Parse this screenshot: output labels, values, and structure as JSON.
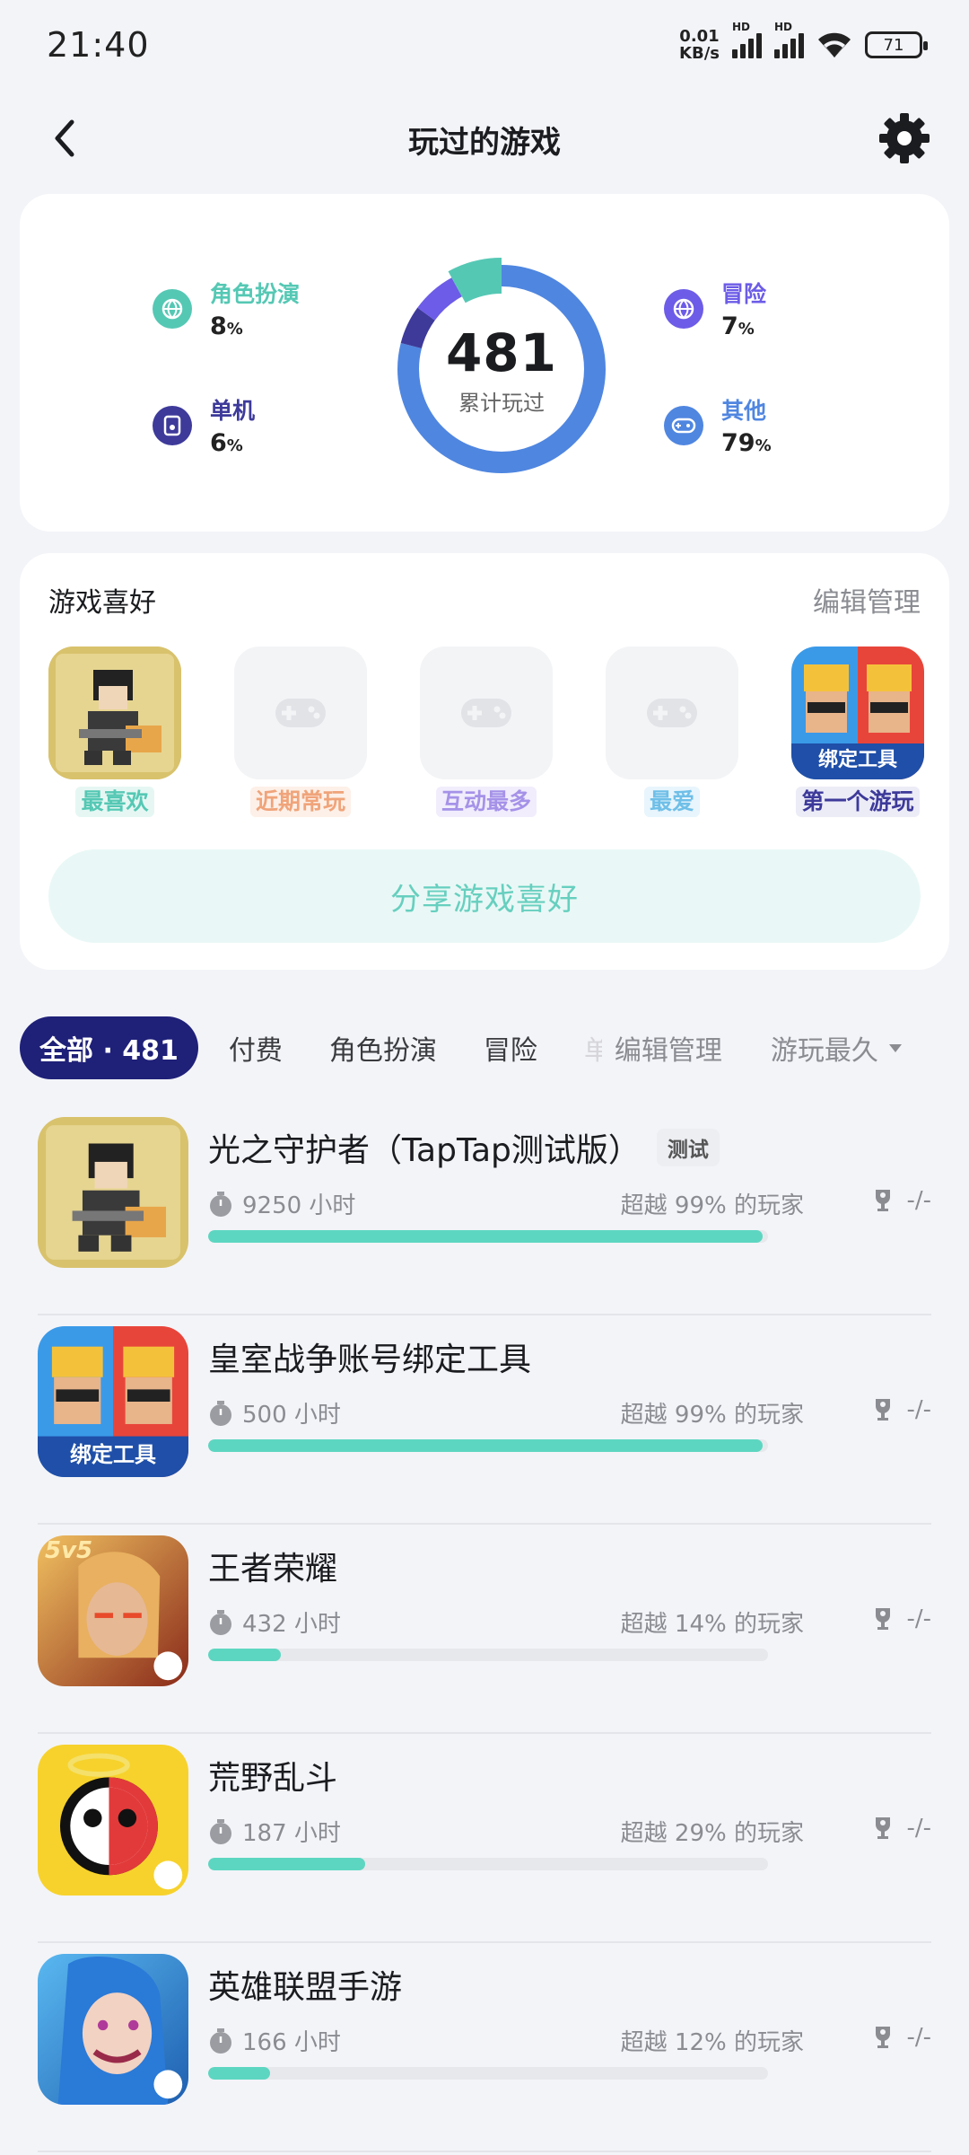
{
  "status_bar": {
    "time": "21:40",
    "net_speed_value": "0.01",
    "net_speed_unit": "KB/s",
    "hd1": "HD",
    "hd2": "HD",
    "battery": "71"
  },
  "header": {
    "title": "玩过的游戏"
  },
  "stats": {
    "total": "481",
    "total_label": "累计玩过",
    "categories": [
      {
        "label": "角色扮演",
        "pct": "8",
        "color": "#55c8b4"
      },
      {
        "label": "单机",
        "pct": "6",
        "color": "#3d3a9a"
      },
      {
        "label": "冒险",
        "pct": "7",
        "color": "#6c5ce7"
      },
      {
        "label": "其他",
        "pct": "79",
        "color": "#4f86e0"
      }
    ],
    "pct_symbol": "%"
  },
  "preferences": {
    "title": "游戏喜好",
    "edit": "编辑管理",
    "slots": [
      {
        "label": "最喜欢",
        "color": "#55c8b4",
        "bg": "#e6f7f3"
      },
      {
        "label": "近期常玩",
        "color": "#f0a47a",
        "bg": "#fdf0e8"
      },
      {
        "label": "互动最多",
        "color": "#a592e8",
        "bg": "#f1edfc"
      },
      {
        "label": "最爱",
        "color": "#6fbfe8",
        "bg": "#e8f5fc"
      },
      {
        "label": "第一个游玩",
        "color": "#3d3a9a",
        "bg": "#ececf7"
      }
    ],
    "bind_badge": "绑定工具",
    "share": "分享游戏喜好"
  },
  "tabs": {
    "active": "全部 · 481",
    "items": [
      "付费",
      "角色扮演",
      "冒险"
    ],
    "faded": "单",
    "edit": "编辑管理",
    "sort": "游玩最久"
  },
  "games": [
    {
      "name": "光之守护者（TapTap测试版）",
      "tag": "测试",
      "hours": "9250 小时",
      "beat": "超越 99% 的玩家",
      "trophy": "-/-",
      "progress": 0.99
    },
    {
      "name": "皇室战争账号绑定工具",
      "tag": "",
      "hours": "500 小时",
      "beat": "超越 99% 的玩家",
      "trophy": "-/-",
      "progress": 0.99,
      "badge": "绑定工具"
    },
    {
      "name": "王者荣耀",
      "tag": "",
      "hours": "432 小时",
      "beat": "超越 14% 的玩家",
      "trophy": "-/-",
      "progress": 0.13,
      "badge": "5v5"
    },
    {
      "name": "荒野乱斗",
      "tag": "",
      "hours": "187 小时",
      "beat": "超越 29% 的玩家",
      "trophy": "-/-",
      "progress": 0.28
    },
    {
      "name": "英雄联盟手游",
      "tag": "",
      "hours": "166 小时",
      "beat": "超越 12% 的玩家",
      "trophy": "-/-",
      "progress": 0.11
    }
  ]
}
